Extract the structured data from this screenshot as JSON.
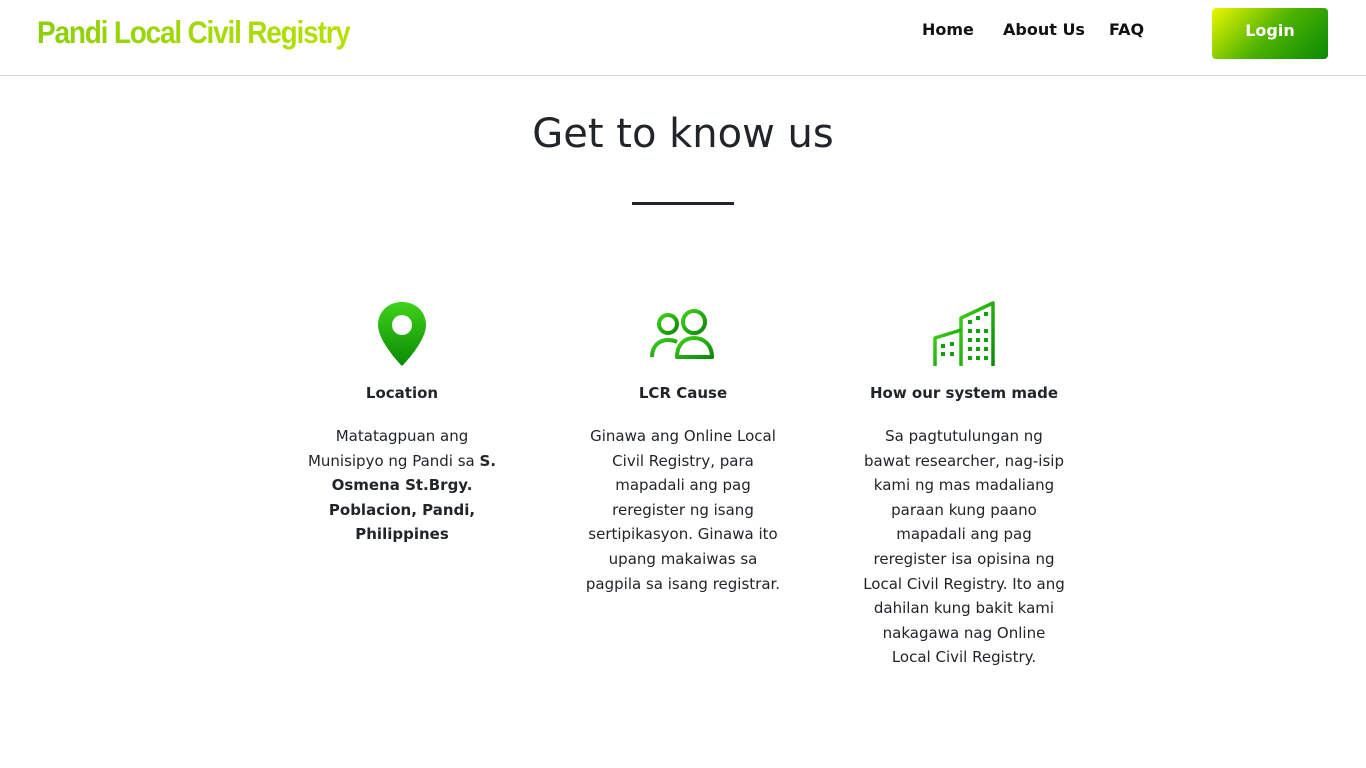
{
  "header": {
    "brand": "Pandi Local Civil Registry",
    "nav": {
      "home": "Home",
      "about": "About Us",
      "faq": "FAQ"
    },
    "login_label": "Login"
  },
  "hero": {
    "title": "Get to know us"
  },
  "cards": [
    {
      "icon": "location-pin-icon",
      "title": "Location",
      "text_plain": "Matatagpuan ang Munisipyo ng Pandi sa ",
      "text_bold": "S. Osmena St.Brgy. Poblacion, Pandi, Philippines"
    },
    {
      "icon": "people-icon",
      "title": "LCR Cause",
      "text": "Ginawa ang Online Local Civil Registry, para mapadali ang pag reregister ng isang sertipikasyon. Ginawa ito upang makaiwas sa pagpila sa isang registrar."
    },
    {
      "icon": "buildings-icon",
      "title": "How our system made",
      "text": "Sa pagtutulungan ng bawat researcher, nag-isip kami ng mas madaliang paraan kung paano mapadali ang pag reregister isa opisina ng Local Civil Registry. Ito ang dahilan kung bakit kami nakagawa nag Online Local Civil Registry."
    }
  ],
  "colors": {
    "accent_green": "#14a800",
    "accent_dark_green": "#078a05",
    "accent_yellow": "#ecf700"
  }
}
